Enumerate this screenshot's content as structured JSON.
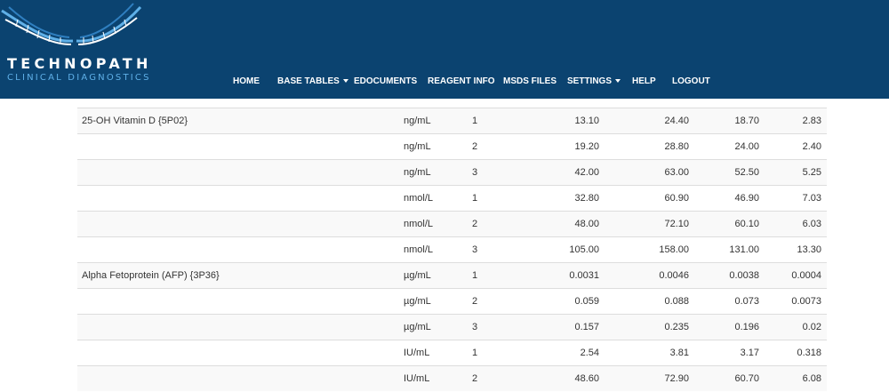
{
  "brand": {
    "name_line1": "TECHNOPATH",
    "name_line2": "CLINICAL DIAGNOSTICS",
    "header_bg": "#0b4370",
    "accent": "#5fb0e8"
  },
  "nav": {
    "items": [
      {
        "label": "HOME",
        "dropdown": false
      },
      {
        "label": "BASE TABLES",
        "dropdown": true
      },
      {
        "label": "EDOCUMENTS",
        "dropdown": false
      },
      {
        "label": "REAGENT INFO",
        "dropdown": false
      },
      {
        "label": "MSDS FILES",
        "dropdown": false
      },
      {
        "label": "SETTINGS",
        "dropdown": true
      },
      {
        "label": "HELP",
        "dropdown": false
      },
      {
        "label": "LOGOUT",
        "dropdown": false
      }
    ]
  },
  "table": {
    "rows": [
      {
        "test": "25-OH Vitamin D {5P02}",
        "unit": "ng/mL",
        "level": "1",
        "v1": "13.10",
        "v2": "24.40",
        "v3": "18.70",
        "v4": "2.83"
      },
      {
        "test": "",
        "unit": "ng/mL",
        "level": "2",
        "v1": "19.20",
        "v2": "28.80",
        "v3": "24.00",
        "v4": "2.40"
      },
      {
        "test": "",
        "unit": "ng/mL",
        "level": "3",
        "v1": "42.00",
        "v2": "63.00",
        "v3": "52.50",
        "v4": "5.25"
      },
      {
        "test": "",
        "unit": "nmol/L",
        "level": "1",
        "v1": "32.80",
        "v2": "60.90",
        "v3": "46.90",
        "v4": "7.03"
      },
      {
        "test": "",
        "unit": "nmol/L",
        "level": "2",
        "v1": "48.00",
        "v2": "72.10",
        "v3": "60.10",
        "v4": "6.03"
      },
      {
        "test": "",
        "unit": "nmol/L",
        "level": "3",
        "v1": "105.00",
        "v2": "158.00",
        "v3": "131.00",
        "v4": "13.30"
      },
      {
        "test": "Alpha Fetoprotein (AFP) {3P36}",
        "unit": "µg/mL",
        "level": "1",
        "v1": "0.0031",
        "v2": "0.0046",
        "v3": "0.0038",
        "v4": "0.0004"
      },
      {
        "test": "",
        "unit": "µg/mL",
        "level": "2",
        "v1": "0.059",
        "v2": "0.088",
        "v3": "0.073",
        "v4": "0.0073"
      },
      {
        "test": "",
        "unit": "µg/mL",
        "level": "3",
        "v1": "0.157",
        "v2": "0.235",
        "v3": "0.196",
        "v4": "0.02"
      },
      {
        "test": "",
        "unit": "IU/mL",
        "level": "1",
        "v1": "2.54",
        "v2": "3.81",
        "v3": "3.17",
        "v4": "0.318"
      },
      {
        "test": "",
        "unit": "IU/mL",
        "level": "2",
        "v1": "48.60",
        "v2": "72.90",
        "v3": "60.70",
        "v4": "6.08"
      }
    ]
  }
}
